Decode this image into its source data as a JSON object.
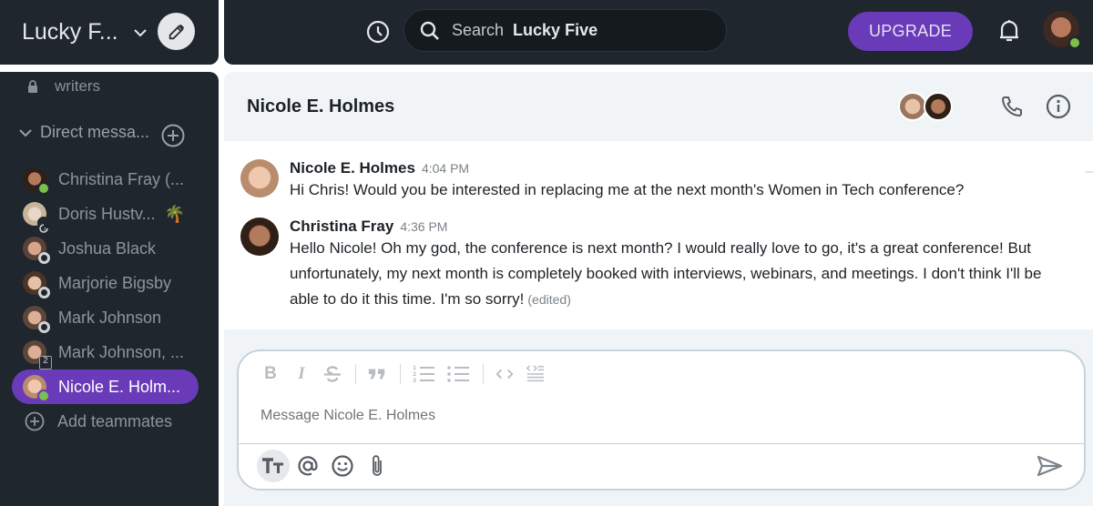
{
  "workspace": {
    "name": "Lucky F...",
    "menu_icon": "chevron-down-icon",
    "compose_icon": "pencil-icon"
  },
  "sidebar": {
    "channel": {
      "name": "writers",
      "icon": "lock-icon"
    },
    "dm_section": {
      "label": "Direct messa...",
      "add_icon": "plus-circle-icon"
    },
    "direct_messages": [
      {
        "name": "Christina Fray (...",
        "status": "online",
        "emoji": ""
      },
      {
        "name": "Doris Hustv...",
        "status": "dnd",
        "emoji": "🌴"
      },
      {
        "name": "Joshua Black",
        "status": "away",
        "emoji": ""
      },
      {
        "name": "Marjorie Bigsby",
        "status": "away",
        "emoji": ""
      },
      {
        "name": "Mark Johnson",
        "status": "away",
        "emoji": ""
      },
      {
        "name": "Mark Johnson, ...",
        "status": "group",
        "count": "2",
        "emoji": ""
      },
      {
        "name": "Nicole E. Holm...",
        "status": "online",
        "emoji": "",
        "active": true
      }
    ],
    "add_teammates": "Add teammates"
  },
  "topbar": {
    "history_icon": "clock-icon",
    "search": {
      "label": "Search",
      "scope": "Lucky Five",
      "icon": "search-icon"
    },
    "upgrade_label": "UPGRADE",
    "notifications_icon": "bell-icon",
    "profile_status": "online"
  },
  "channel": {
    "title": "Nicole E. Holmes",
    "call_icon": "phone-icon",
    "info_icon": "info-icon"
  },
  "messages": [
    {
      "author": "Nicole E. Holmes",
      "time": "4:04 PM",
      "text": "Hi Chris! Would you be interested in replacing me at the next month's Women in Tech conference?",
      "edited": ""
    },
    {
      "author": "Christina Fray",
      "time": "4:36 PM",
      "text": "Hello Nicole! Oh my god, the conference is next month? I would really love to go, it's a great conference! But unfortunately, my next month is completely booked with interviews, webinars, and meetings. I don't think I'll be able to do it this time. I'm so sorry!",
      "edited": "(edited)"
    }
  ],
  "composer": {
    "placeholder": "Message Nicole E. Holmes",
    "format_tools": [
      "bold",
      "italic",
      "strikethrough",
      "quote",
      "numbered-list",
      "bulleted-list",
      "code",
      "code-block"
    ],
    "bottom_tools": [
      "text-format",
      "mention",
      "emoji",
      "attachment"
    ],
    "send_icon": "send-icon"
  },
  "colors": {
    "accent": "#6a3bb8",
    "sidebar_bg": "#1f262d",
    "online": "#7cc04b"
  }
}
